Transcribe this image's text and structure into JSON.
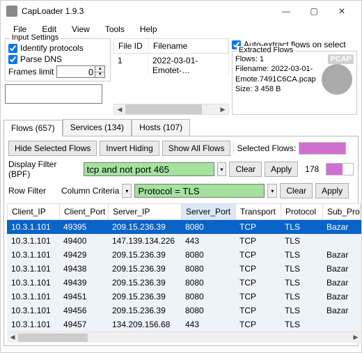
{
  "title": "CapLoader 1.9.3",
  "menu": [
    "File",
    "Edit",
    "View",
    "Tools",
    "Help"
  ],
  "input_settings": {
    "legend": "Input Settings",
    "identify_label": "Identify protocols",
    "parse_dns_label": "Parse DNS",
    "frames_limit_label": "Frames limit",
    "frames_limit_value": "0"
  },
  "filelist": {
    "cols": [
      "File ID",
      "Filename"
    ],
    "rows": [
      {
        "id": "1",
        "name": "2022-03-01-Emotet-…"
      }
    ]
  },
  "extracted": {
    "auto_label": "Auto-extract flows on select",
    "legend": "Extracted Flows",
    "flows_label": "Flows: 1",
    "filename_label": "Filename: 2022-03-01-Emote.7491C6CA.pcap",
    "size_label": "Size: 3 458 B",
    "pcap_badge": "PCAP"
  },
  "tabs": [
    {
      "label": "Flows (657)"
    },
    {
      "label": "Services (134)"
    },
    {
      "label": "Hosts (107)"
    }
  ],
  "toolbar": {
    "hide": "Hide Selected Flows",
    "invert": "Invert Hiding",
    "showall": "Show All Flows",
    "selected": "Selected Flows:"
  },
  "bpf": {
    "label": "Display Filter (BPF)",
    "value": "tcp and not port 465",
    "clear": "Clear",
    "apply": "Apply",
    "count": "178"
  },
  "rowfilter": {
    "label": "Row Filter",
    "criteria_label": "Column Criteria",
    "value": "Protocol = TLS",
    "clear": "Clear",
    "apply": "Apply"
  },
  "grid": {
    "cols": [
      "Client_IP",
      "Client_Port",
      "Server_IP",
      "Server_Port",
      "Transport",
      "Protocol",
      "Sub_Prot"
    ],
    "sorted_col": 3,
    "rows": [
      {
        "sel": true,
        "cells": [
          "10.3.1.101",
          "49395",
          "209.15.236.39",
          "8080",
          "TCP",
          "TLS",
          "Bazar"
        ]
      },
      {
        "sel": false,
        "cells": [
          "10.3.1.101",
          "49400",
          "147.139.134.226",
          "443",
          "TCP",
          "TLS",
          ""
        ]
      },
      {
        "sel": false,
        "cells": [
          "10.3.1.101",
          "49429",
          "209.15.236.39",
          "8080",
          "TCP",
          "TLS",
          "Bazar"
        ]
      },
      {
        "sel": false,
        "cells": [
          "10.3.1.101",
          "49438",
          "209.15.236.39",
          "8080",
          "TCP",
          "TLS",
          "Bazar"
        ]
      },
      {
        "sel": false,
        "cells": [
          "10.3.1.101",
          "49439",
          "209.15.236.39",
          "8080",
          "TCP",
          "TLS",
          "Bazar"
        ]
      },
      {
        "sel": false,
        "cells": [
          "10.3.1.101",
          "49451",
          "209.15.236.39",
          "8080",
          "TCP",
          "TLS",
          "Bazar"
        ]
      },
      {
        "sel": false,
        "cells": [
          "10.3.1.101",
          "49456",
          "209.15.236.39",
          "8080",
          "TCP",
          "TLS",
          "Bazar"
        ]
      },
      {
        "sel": false,
        "cells": [
          "10.3.1.101",
          "49457",
          "134.209.156.68",
          "443",
          "TCP",
          "TLS",
          ""
        ]
      }
    ]
  }
}
